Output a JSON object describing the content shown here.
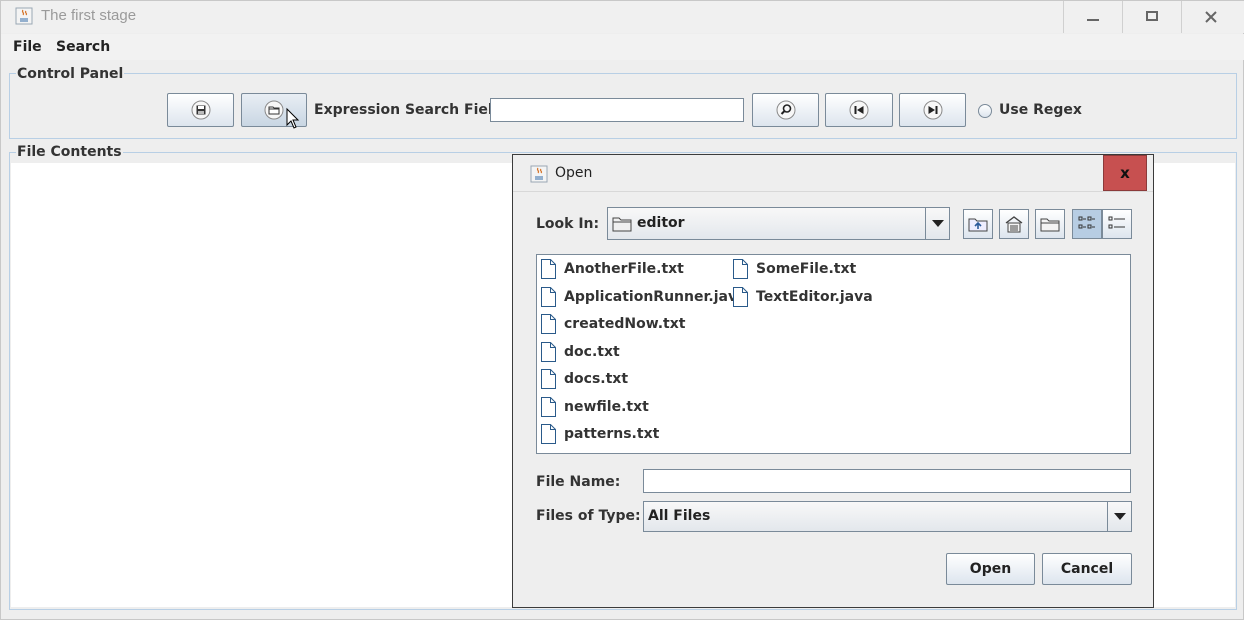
{
  "window": {
    "title": "The first stage"
  },
  "menu": {
    "file": "File",
    "search": "Search"
  },
  "control_panel": {
    "legend": "Control Panel",
    "search_label": "Expression Search Field",
    "search_value": "",
    "use_regex": "Use Regex",
    "use_regex_checked": false
  },
  "file_contents": {
    "legend": "File Contents"
  },
  "dialog": {
    "title": "Open",
    "close": "x",
    "look_in_label": "Look In:",
    "look_in_value": "editor",
    "files_col1": [
      "AnotherFile.txt",
      "ApplicationRunner.java",
      "createdNow.txt",
      "doc.txt",
      "docs.txt",
      "newfile.txt",
      "patterns.txt"
    ],
    "files_col2": [
      "SomeFile.txt",
      "TextEditor.java"
    ],
    "file_name_label": "File Name:",
    "file_name_value": "",
    "file_type_label": "Files of Type:",
    "file_type_value": "All Files",
    "open_button": "Open",
    "cancel_button": "Cancel"
  }
}
